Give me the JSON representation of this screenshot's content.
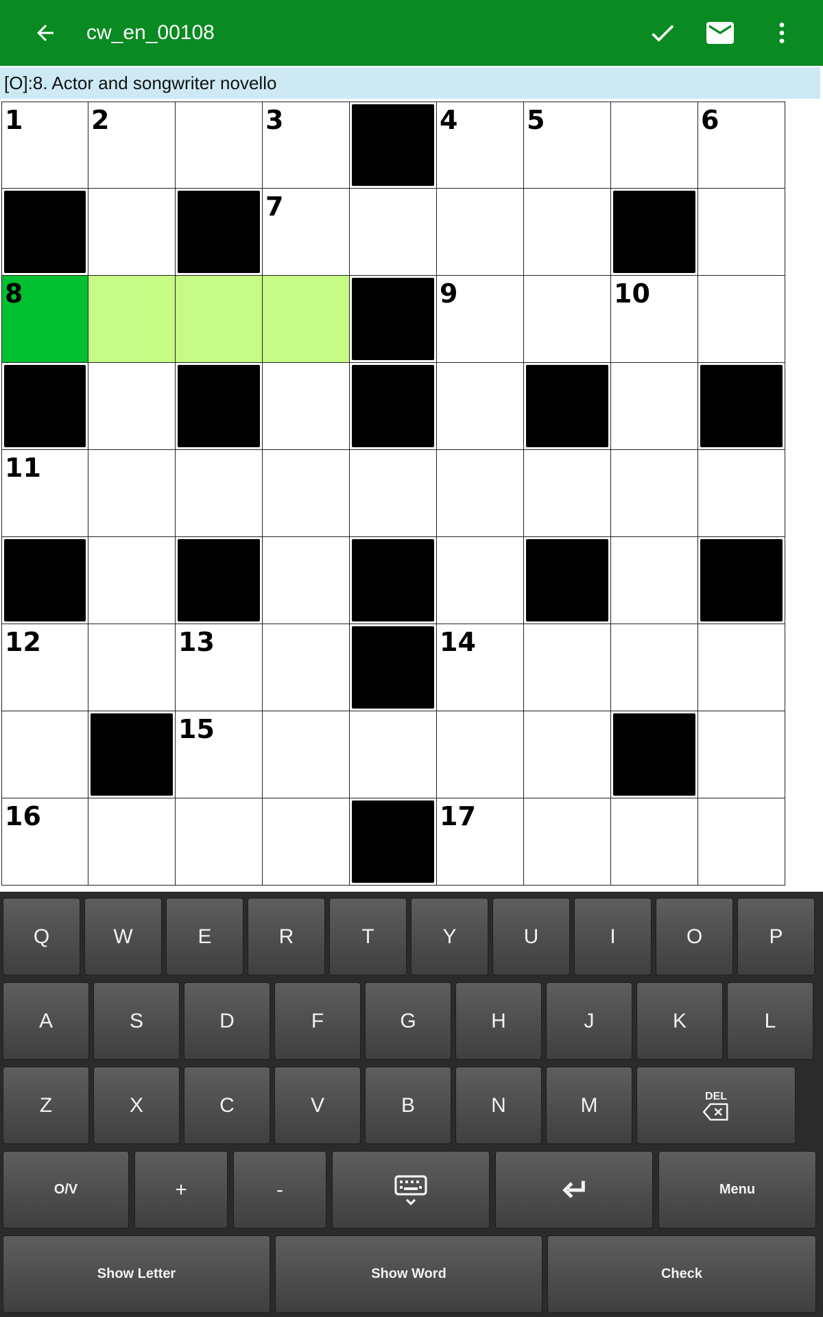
{
  "app_bar": {
    "title": "cw_en_00108",
    "back_icon": "arrow-left-icon",
    "actions": [
      "check-icon",
      "mail-icon",
      "more-vertical-icon"
    ]
  },
  "clue": {
    "text": "[O]:8. Actor and songwriter novello"
  },
  "grid": {
    "rows": 9,
    "cols": 9,
    "layout": [
      "....#....",
      "#.#....#.",
      "....#....",
      "#.#.#.#.#",
      ".........",
      "#.#.#.#.#",
      "....#....",
      ".#.....#.",
      "....#...."
    ],
    "numbers": [
      {
        "row": 0,
        "col": 0,
        "n": "1"
      },
      {
        "row": 0,
        "col": 1,
        "n": "2"
      },
      {
        "row": 0,
        "col": 3,
        "n": "3"
      },
      {
        "row": 0,
        "col": 5,
        "n": "4"
      },
      {
        "row": 0,
        "col": 6,
        "n": "5"
      },
      {
        "row": 0,
        "col": 8,
        "n": "6"
      },
      {
        "row": 1,
        "col": 3,
        "n": "7"
      },
      {
        "row": 2,
        "col": 0,
        "n": "8"
      },
      {
        "row": 2,
        "col": 5,
        "n": "9"
      },
      {
        "row": 2,
        "col": 7,
        "n": "10"
      },
      {
        "row": 4,
        "col": 0,
        "n": "11"
      },
      {
        "row": 6,
        "col": 0,
        "n": "12"
      },
      {
        "row": 6,
        "col": 2,
        "n": "13"
      },
      {
        "row": 6,
        "col": 5,
        "n": "14"
      },
      {
        "row": 7,
        "col": 2,
        "n": "15"
      },
      {
        "row": 8,
        "col": 0,
        "n": "16"
      },
      {
        "row": 8,
        "col": 5,
        "n": "17"
      }
    ],
    "active_cell": {
      "row": 2,
      "col": 0
    },
    "highlighted_word": [
      {
        "row": 2,
        "col": 1
      },
      {
        "row": 2,
        "col": 2
      },
      {
        "row": 2,
        "col": 3
      }
    ],
    "colors": {
      "active": "#00c030",
      "word": "#c6fb86",
      "block": "#000000"
    }
  },
  "keyboard": {
    "row1": [
      "Q",
      "W",
      "E",
      "R",
      "T",
      "Y",
      "U",
      "I",
      "O",
      "P"
    ],
    "row2": [
      "A",
      "S",
      "D",
      "F",
      "G",
      "H",
      "J",
      "K",
      "L"
    ],
    "row3": [
      "Z",
      "X",
      "C",
      "V",
      "B",
      "N",
      "M"
    ],
    "delete_label": "DEL",
    "row4": {
      "toggle": "O/V",
      "plus": "+",
      "minus": "-",
      "keyboard_icon": "keyboard-hide-icon",
      "enter_icon": "enter-icon",
      "menu": "Menu"
    },
    "row5": {
      "show_letter": "Show Letter",
      "show_word": "Show Word",
      "check": "Check"
    }
  },
  "colors": {
    "app_bar": "#0a8a22",
    "clue_bar": "#cdeaf4",
    "keyboard_bg": "#2b2b2b"
  }
}
